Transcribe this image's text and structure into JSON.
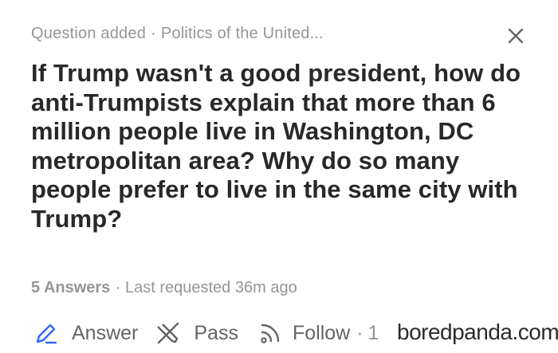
{
  "header": {
    "status": "Question added",
    "separator": "·",
    "topic": "Politics of the United..."
  },
  "question": {
    "title": "If Trump wasn't a good president, how do anti-Trumpists explain that more than 6 million people live in Washington, DC metropolitan area? Why do so many people prefer to live in the same city with Trump?"
  },
  "meta": {
    "answers": "5 Answers",
    "separator": "·",
    "last_requested": "Last requested 36m ago"
  },
  "actions": {
    "answer_label": "Answer",
    "pass_label": "Pass",
    "follow_label": "Follow",
    "follow_separator": "·",
    "follow_count": "1"
  },
  "watermark": "boredpanda.com",
  "colors": {
    "accent": "#2e69ff",
    "text": "#282829",
    "muted": "#939598",
    "icon": "#636466"
  },
  "icons": {
    "close": "close-icon",
    "answer": "pencil-icon",
    "pass": "pass-icon",
    "follow": "wifi-icon"
  }
}
